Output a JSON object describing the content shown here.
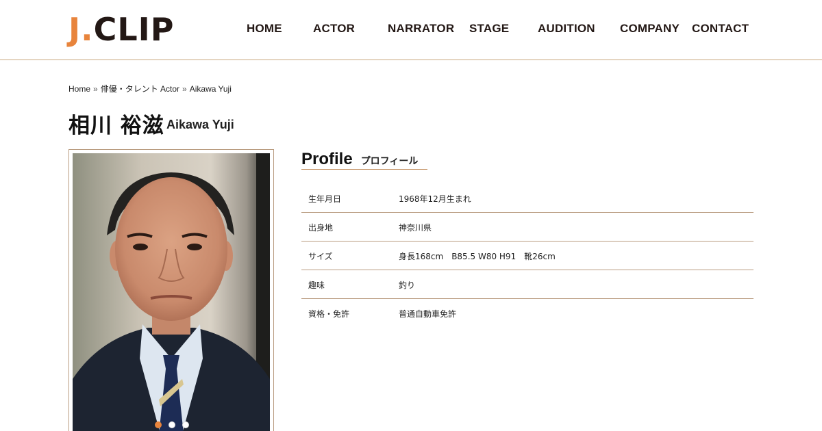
{
  "brand": {
    "logo_j": "J",
    "logo_dot": ".",
    "logo_clip": "CLIP",
    "accent_color": "#e8843c",
    "text_color": "#231815"
  },
  "nav": {
    "items": [
      {
        "label": "HOME"
      },
      {
        "label": "ACTOR"
      },
      {
        "label": "NARRATOR"
      },
      {
        "label": "STAGE"
      },
      {
        "label": "AUDITION"
      },
      {
        "label": "COMPANY"
      },
      {
        "label": "CONTACT"
      }
    ]
  },
  "breadcrumb": {
    "home": "Home",
    "separator": "»",
    "category": "俳優・タレント Actor",
    "current": "Aikawa Yuji"
  },
  "person": {
    "name_jp": "相川 裕滋",
    "name_en": "Aikawa Yuji"
  },
  "gallery": {
    "slide_count": 3,
    "active_index": 0
  },
  "profile": {
    "heading_en": "Profile",
    "heading_jp": "プロフィール",
    "rows": [
      {
        "label": "生年月日",
        "value": "1968年12月生まれ"
      },
      {
        "label": "出身地",
        "value": "神奈川県"
      },
      {
        "label": "サイズ",
        "value": "身長168cm　B85.5 W80 H91　靴26cm"
      },
      {
        "label": "趣味",
        "value": "釣り"
      },
      {
        "label": "資格・免許",
        "value": "普通自動車免許"
      }
    ]
  }
}
